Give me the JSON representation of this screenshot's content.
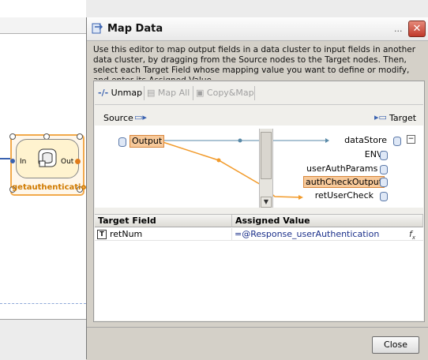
{
  "background": {
    "node": {
      "label": "getauthentication",
      "in_label": "In",
      "out_label": "Out"
    }
  },
  "dialog": {
    "title": "Map Data",
    "title_more": "...",
    "close_x": "✕",
    "description": "Use this editor to map output fields in a data cluster to input fields in another data cluster, by dragging from the Source nodes to the Target nodes. Then, select each Target Field whose mapping value you want to define or modify, and enter its Assigned Value.",
    "toolbar": {
      "unmap": "Unmap",
      "map_all": "Map All",
      "copy_map": "Copy&Map"
    },
    "source_label": "Source",
    "target_label": "Target",
    "source_node": "Output",
    "target_nodes": [
      "dataStore",
      "ENV_",
      "userAuthParams",
      "authCheckOutput",
      "retUserCheck"
    ],
    "table": {
      "headers": [
        "Target Field",
        "Assigned Value"
      ],
      "rows": [
        {
          "field": "retNum",
          "value": "=@Response_userAuthentication"
        }
      ]
    },
    "close_button": "Close",
    "colors": {
      "mapping_line": "#f29b2b",
      "mapping_line_blue": "#5a8aa8",
      "highlight": "#f7c99a"
    }
  }
}
